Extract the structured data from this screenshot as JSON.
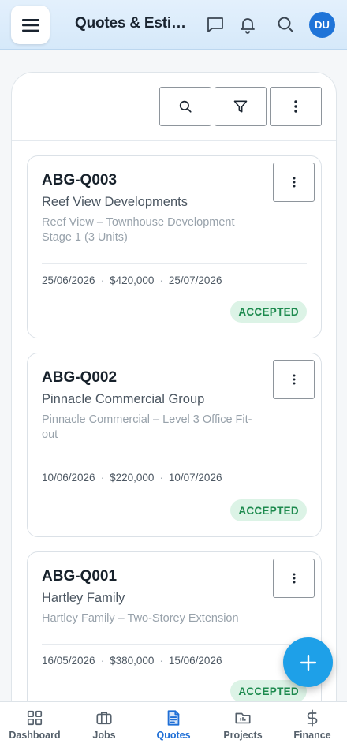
{
  "header": {
    "title": "Quotes & Estimates",
    "avatar_initials": "DU",
    "icons": [
      "hamburger-menu-icon",
      "chat-icon",
      "bell-icon",
      "search-icon"
    ]
  },
  "toolbar": {
    "icons": [
      "search-icon",
      "filter-icon",
      "more-vertical-icon"
    ]
  },
  "quotes": [
    {
      "id": "ABG-Q003",
      "client": "Reef View Developments",
      "project": "Reef View – Townhouse Development Stage 1 (3 Units)",
      "date": "25/06/2026",
      "amount": "$420,000",
      "valid_until": "25/07/2026",
      "status": "ACCEPTED"
    },
    {
      "id": "ABG-Q002",
      "client": "Pinnacle Commercial Group",
      "project": "Pinnacle Commercial – Level 3 Office Fit-out",
      "date": "10/06/2026",
      "amount": "$220,000",
      "valid_until": "10/07/2026",
      "status": "ACCEPTED"
    },
    {
      "id": "ABG-Q001",
      "client": "Hartley Family",
      "project": "Hartley Family – Two-Storey Extension",
      "date": "16/05/2026",
      "amount": "$380,000",
      "valid_until": "15/06/2026",
      "status": "ACCEPTED"
    }
  ],
  "meta_separator": "·",
  "fab_icon": "plus-icon",
  "bottom_nav": [
    {
      "label": "Dashboard",
      "icon": "dashboard-icon",
      "active": false
    },
    {
      "label": "Jobs",
      "icon": "briefcase-icon",
      "active": false
    },
    {
      "label": "Quotes",
      "icon": "document-icon",
      "active": true
    },
    {
      "label": "Projects",
      "icon": "folder-icon",
      "active": false
    },
    {
      "label": "Finance",
      "icon": "dollar-icon",
      "active": false
    }
  ],
  "colors": {
    "accent": "#1f6fd6",
    "fab": "#1ea0e8",
    "badge_bg": "#dcf3e6",
    "badge_text": "#1d8a4e",
    "header_bg": "#d6e9fa"
  }
}
